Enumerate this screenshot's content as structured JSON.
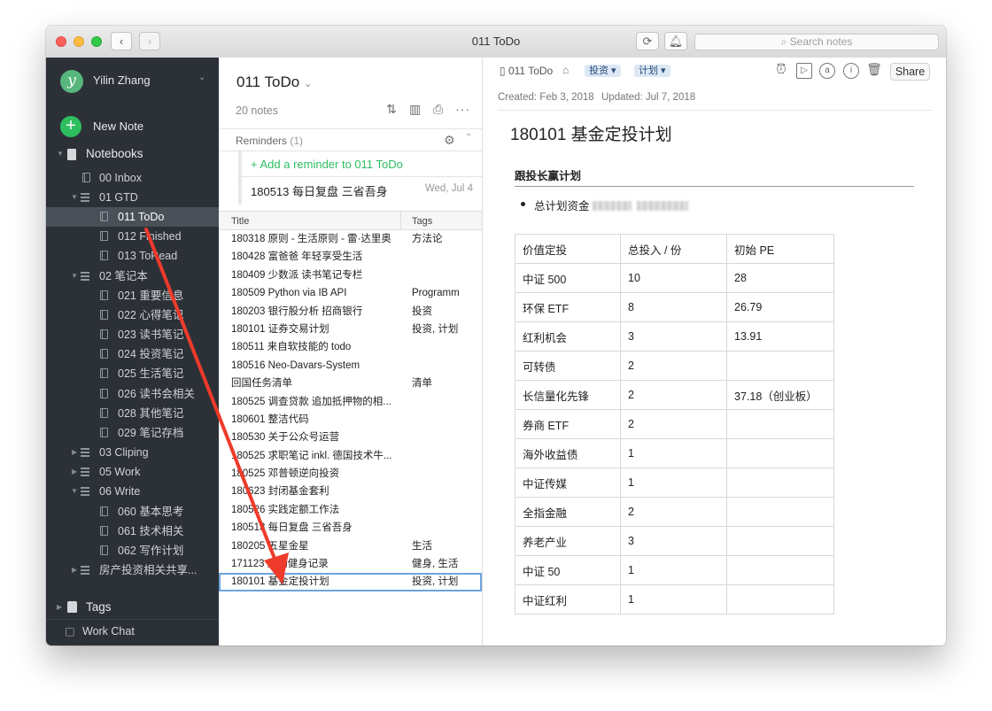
{
  "window": {
    "title": "011 ToDo",
    "search_placeholder": "Search notes"
  },
  "sidebar": {
    "user": {
      "avatar_letter": "y",
      "name": "Yilin Zhang"
    },
    "new_note": "New Note",
    "notebooks_label": "Notebooks",
    "items": [
      {
        "label": "00 Inbox"
      },
      {
        "label": "01 GTD"
      },
      {
        "label": "011 ToDo"
      },
      {
        "label": "012 Finished"
      },
      {
        "label": "013 ToRead"
      },
      {
        "label": "02 笔记本"
      },
      {
        "label": "021 重要信息"
      },
      {
        "label": "022 心得笔记"
      },
      {
        "label": "023 读书笔记"
      },
      {
        "label": "024 投资笔记"
      },
      {
        "label": "025 生活笔记"
      },
      {
        "label": "026 读书会相关"
      },
      {
        "label": "028 其他笔记"
      },
      {
        "label": "029 笔记存档"
      },
      {
        "label": "03 Cliping"
      },
      {
        "label": "05 Work"
      },
      {
        "label": "06 Write"
      },
      {
        "label": "060 基本思考"
      },
      {
        "label": "061 技术相关"
      },
      {
        "label": "062 写作计划"
      },
      {
        "label": "房产投资相关共享..."
      }
    ],
    "tags_label": "Tags",
    "work_chat_label": "Work Chat"
  },
  "notelist": {
    "title": "011 ToDo",
    "count": "20 notes",
    "reminders_label": "Reminders",
    "reminders_count": "(1)",
    "add_reminder": "+ Add a reminder to 011 ToDo",
    "reminder_item": {
      "title": "180513 每日复盘 三省吾身",
      "date": "Wed, Jul 4"
    },
    "columns": {
      "title": "Title",
      "tags": "Tags"
    },
    "rows": [
      {
        "title": "180318 原则 - 生活原则 - 雷·达里奥",
        "tags": "方法论"
      },
      {
        "title": "180428 富爸爸 年轻享受生活",
        "tags": ""
      },
      {
        "title": "180409 少数派 读书笔记专栏",
        "tags": ""
      },
      {
        "title": "180509 Python via IB API",
        "tags": "Programm"
      },
      {
        "title": "180203 银行股分析 招商银行",
        "tags": "投资"
      },
      {
        "title": "180101 证券交易计划",
        "tags": "投资, 计划"
      },
      {
        "title": "180511 来自软技能的 todo",
        "tags": ""
      },
      {
        "title": "180516 Neo-Davars-System",
        "tags": ""
      },
      {
        "title": "回国任务清单",
        "tags": "清单"
      },
      {
        "title": "180525 调查贷款 追加抵押物的相...",
        "tags": ""
      },
      {
        "title": "180601 整洁代码",
        "tags": ""
      },
      {
        "title": "180530 关于公众号运营",
        "tags": ""
      },
      {
        "title": "180525 求职笔记 inkl. 德国技术牛...",
        "tags": ""
      },
      {
        "title": "180525 邓普顿逆向投资",
        "tags": ""
      },
      {
        "title": "180623 封闭基金套利",
        "tags": ""
      },
      {
        "title": "180526 实践定额工作法",
        "tags": ""
      },
      {
        "title": "180513 每日复盘 三省吾身",
        "tags": ""
      },
      {
        "title": "180205 五星金星",
        "tags": "生活"
      },
      {
        "title": "171123 运动健身记录",
        "tags": "健身, 生活"
      },
      {
        "title": "180101 基金定投计划",
        "tags": "投资, 计划"
      }
    ]
  },
  "editor": {
    "notebook": "011 ToDo",
    "tags": [
      "投资",
      "计划"
    ],
    "share": "Share",
    "created": "Created: Feb 3, 2018",
    "updated": "Updated: Jul 7, 2018",
    "title": "180101 基金定投计划",
    "heading": "跟投长赢计划",
    "bullet": "总计划资金",
    "table": {
      "header": [
        "价值定投",
        "总投入 / 份",
        "初始 PE"
      ],
      "rows": [
        [
          "中证 500",
          "10",
          "28"
        ],
        [
          "环保 ETF",
          "8",
          "26.79"
        ],
        [
          "红利机会",
          "3",
          "13.91"
        ],
        [
          "可转债",
          "2",
          ""
        ],
        [
          "长信量化先锋",
          "2",
          "37.18（创业板）"
        ],
        [
          "券商 ETF",
          "2",
          ""
        ],
        [
          "海外收益债",
          "1",
          ""
        ],
        [
          "中证传媒",
          "1",
          ""
        ],
        [
          "全指金融",
          "2",
          ""
        ],
        [
          "养老产业",
          "3",
          ""
        ],
        [
          "中证 50",
          "1",
          ""
        ],
        [
          "中证红利",
          "1",
          ""
        ]
      ]
    }
  },
  "colors": {
    "sidebar_bg": "#2c3137",
    "accent_green": "#2dbe60",
    "annotation_arrow": "#ee3b2b"
  }
}
